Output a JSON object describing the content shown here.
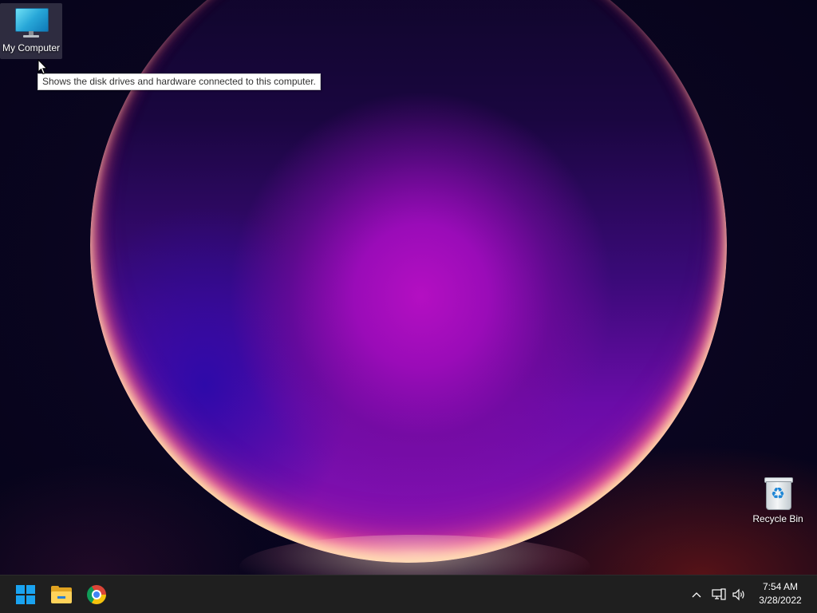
{
  "desktop": {
    "icons": [
      {
        "label": "My Computer",
        "icon": "monitor-icon",
        "selected": true
      },
      {
        "label": "Recycle Bin",
        "icon": "recycle-bin-icon",
        "selected": false
      }
    ],
    "tooltip": "Shows the disk drives and hardware connected to this computer."
  },
  "taskbar": {
    "pinned": [
      {
        "name": "start",
        "icon": "windows-logo-icon"
      },
      {
        "name": "file-explorer",
        "icon": "folder-icon"
      },
      {
        "name": "chrome",
        "icon": "chrome-icon"
      }
    ],
    "tray": {
      "icons": [
        "chevron-up-icon",
        "network-icon",
        "volume-icon"
      ],
      "time": "7:54 AM",
      "date": "3/28/2022"
    }
  },
  "colors": {
    "taskbar_bg": "#1f1f1f",
    "accent": "#1aa3f0"
  }
}
